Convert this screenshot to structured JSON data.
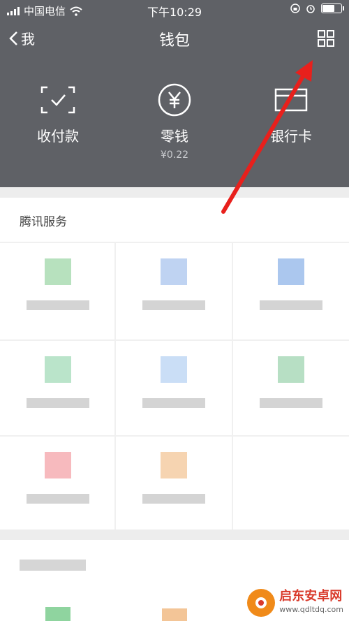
{
  "status": {
    "carrier": "中国电信",
    "time": "下午10:29",
    "battery_level": 0.7
  },
  "nav": {
    "back_label": "我",
    "title": "钱包"
  },
  "shortcuts": [
    {
      "label": "收付款",
      "icon": "scan-icon"
    },
    {
      "label": "零钱",
      "sub": "¥0.22",
      "icon": "yuan-icon"
    },
    {
      "label": "银行卡",
      "icon": "card-icon"
    }
  ],
  "services": {
    "title": "腾讯服务",
    "tile_colors": [
      "#9fd7a8",
      "#aac4ee",
      "#8fb4e8",
      "#a3dbb8",
      "#b8d3f3",
      "#9fd4b0",
      "#f4a3a8",
      "#f3c597"
    ]
  },
  "watermark": {
    "title": "启东安卓网",
    "url": "www.qdltdq.com"
  }
}
